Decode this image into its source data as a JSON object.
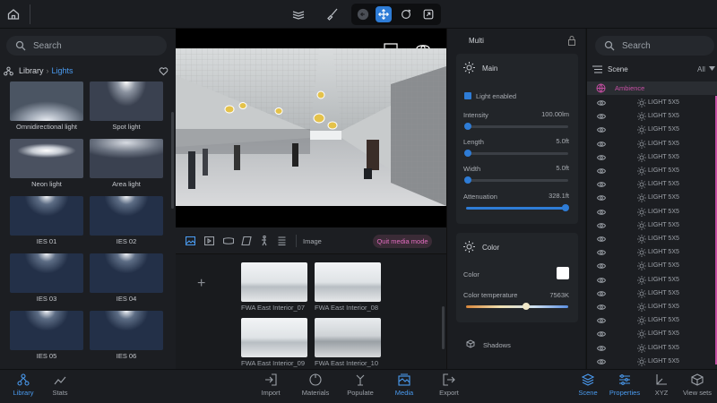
{
  "toolbar": {
    "home": "home-icon",
    "layers": "layers-icon",
    "brush": "brush-icon",
    "undo": "undo-icon",
    "move": "move-icon",
    "rotate": "rotate-icon",
    "scale": "scale-icon"
  },
  "left": {
    "search_placeholder": "Search",
    "breadcrumb_root": "Library",
    "breadcrumb_current": "Lights",
    "items": [
      {
        "label": "Omnidirectional light"
      },
      {
        "label": "Spot light"
      },
      {
        "label": "Neon light"
      },
      {
        "label": "Area light"
      },
      {
        "label": "IES 01"
      },
      {
        "label": "IES 02"
      },
      {
        "label": "IES 03"
      },
      {
        "label": "IES 04"
      },
      {
        "label": "IES 05"
      },
      {
        "label": "IES 06"
      }
    ]
  },
  "media": {
    "tab_label": "Image",
    "quit_label": "Quit media mode",
    "items": [
      {
        "label": "FWA East Interior_07"
      },
      {
        "label": "FWA East Interior_08"
      },
      {
        "label": "FWA East Interior_09"
      },
      {
        "label": "FWA East Interior_10"
      }
    ]
  },
  "props": {
    "title": "Multi",
    "main_section": "Main",
    "light_enabled": "Light enabled",
    "intensity_label": "Intensity",
    "intensity_value": "100.00lm",
    "length_label": "Length",
    "length_value": "5.0ft",
    "width_label": "Width",
    "width_value": "5.0ft",
    "attenuation_label": "Attenuation",
    "attenuation_value": "328.1ft",
    "color_section": "Color",
    "color_label": "Color",
    "color_temp_label": "Color temperature",
    "color_temp_value": "7563K",
    "shadows_label": "Shadows"
  },
  "scene": {
    "search_placeholder": "Search",
    "title": "Scene",
    "filter": "All",
    "group": "Ambience",
    "lights": [
      "LIGHT 5X5",
      "LIGHT 5X5",
      "LIGHT 5X5",
      "LIGHT 5X5",
      "LIGHT 5X5",
      "LIGHT 5X5",
      "LIGHT 5X5",
      "LIGHT 5X5",
      "LIGHT 5X5",
      "LIGHT 5X5",
      "LIGHT 5X5",
      "LIGHT 5X5",
      "LIGHT 5X5",
      "LIGHT 5X5",
      "LIGHT 5X5",
      "LIGHT 5X5",
      "LIGHT 5X5",
      "LIGHT 5X5",
      "LIGHT 5X5",
      "LIGHT 5X5"
    ]
  },
  "bottom": {
    "library": "Library",
    "stats": "Stats",
    "import": "Import",
    "materials": "Materials",
    "populate": "Populate",
    "media": "Media",
    "export": "Export",
    "scene": "Scene",
    "properties": "Properties",
    "xyz": "XYZ",
    "view_sets": "View sets"
  },
  "colors": {
    "accent": "#2e7cd6",
    "pink": "#c74fa4"
  }
}
